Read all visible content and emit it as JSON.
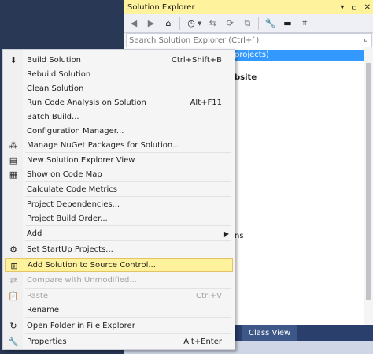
{
  "solution_explorer": {
    "title": "Solution Explorer",
    "title_controls": [
      "▾",
      "ㅁ",
      "✕"
    ],
    "search_placeholder": "Search Solution Explorer (Ctrl+`)",
    "tree_selected_fragment": "projects)",
    "tree_fragments": [
      "bsite",
      "ns"
    ],
    "tabs": [
      "",
      "Class View"
    ]
  },
  "context_menu": {
    "items": [
      {
        "label": "Build Solution",
        "shortcut": "Ctrl+Shift+B",
        "icon": "build-icon"
      },
      {
        "label": "Rebuild Solution",
        "shortcut": ""
      },
      {
        "label": "Clean Solution",
        "shortcut": ""
      },
      {
        "label": "Run Code Analysis on Solution",
        "shortcut": "Alt+F11"
      },
      {
        "label": "Batch Build...",
        "shortcut": ""
      },
      {
        "label": "Configuration Manager...",
        "shortcut": ""
      },
      {
        "label": "Manage NuGet Packages for Solution...",
        "shortcut": "",
        "icon": "nuget-icon"
      },
      {
        "label": "New Solution Explorer View",
        "shortcut": "",
        "icon": "new-view-icon"
      },
      {
        "label": "Show on Code Map",
        "shortcut": "",
        "icon": "code-map-icon"
      },
      {
        "label": "Calculate Code Metrics",
        "shortcut": ""
      },
      {
        "label": "Project Dependencies...",
        "shortcut": ""
      },
      {
        "label": "Project Build Order...",
        "shortcut": ""
      },
      {
        "label": "Add",
        "shortcut": "",
        "submenu": true
      },
      {
        "label": "Set StartUp Projects...",
        "shortcut": "",
        "icon": "gear-icon"
      },
      {
        "label": "Add Solution to Source Control...",
        "shortcut": "",
        "icon": "source-control-icon",
        "highlighted": true
      },
      {
        "label": "Compare with Unmodified...",
        "shortcut": "",
        "icon": "compare-icon",
        "disabled": true
      },
      {
        "label": "Paste",
        "shortcut": "Ctrl+V",
        "icon": "paste-icon",
        "disabled": true
      },
      {
        "label": "Rename",
        "shortcut": ""
      },
      {
        "label": "Open Folder in File Explorer",
        "shortcut": "",
        "icon": "open-folder-icon"
      },
      {
        "label": "Properties",
        "shortcut": "Alt+Enter",
        "icon": "wrench-icon"
      }
    ]
  },
  "colors": {
    "title_bar": "#fff29d",
    "highlight": "#fff29d",
    "selection": "#3399ff",
    "ide_background": "#293955"
  }
}
